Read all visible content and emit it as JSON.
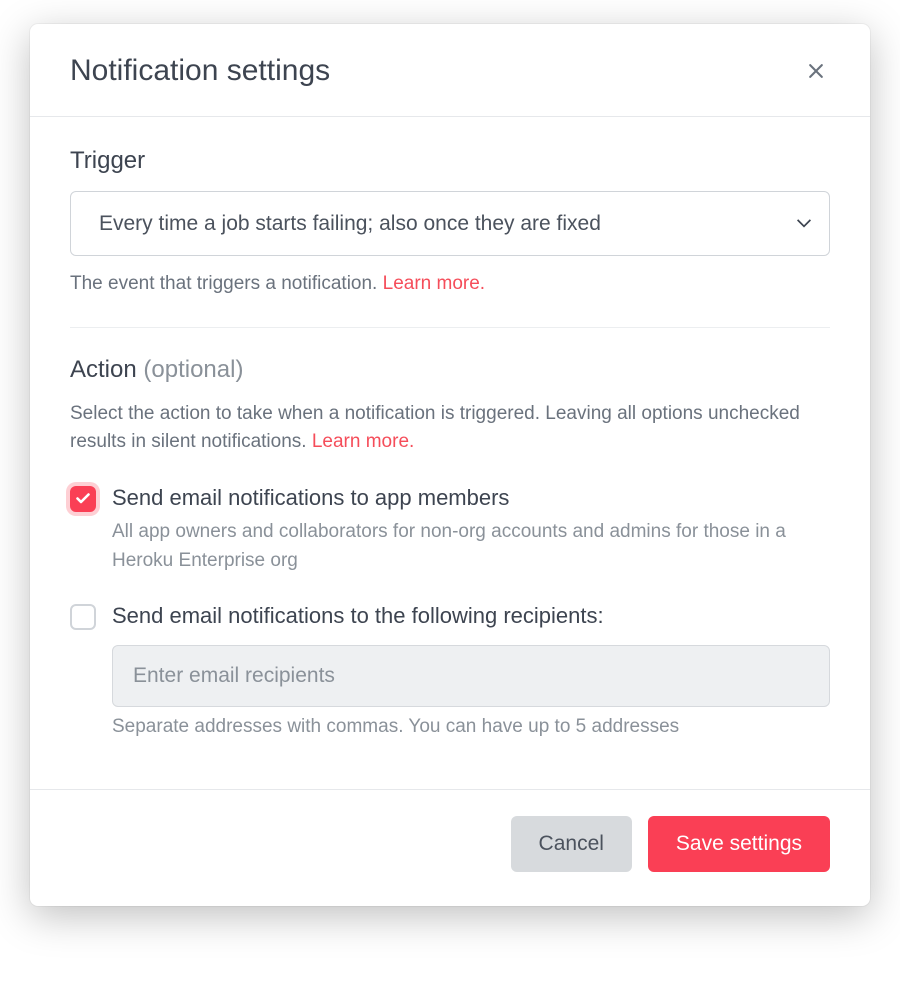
{
  "header": {
    "title": "Notification settings"
  },
  "trigger": {
    "label": "Trigger",
    "selected": "Every time a job starts failing; also once they are fixed",
    "help": "The event that triggers a notification.  ",
    "learn_more": "Learn more."
  },
  "action": {
    "label": "Action ",
    "optional": "(optional)",
    "help": "Select the action to take when a notification is triggered. Leaving all options unchecked results in silent notifications. ",
    "learn_more": "Learn more.",
    "option1": {
      "checked": true,
      "label": "Send email notifications to app members",
      "sub": "All app owners and collaborators for non-org accounts and admins for those in a Heroku Enterprise org"
    },
    "option2": {
      "checked": false,
      "label": "Send email notifications to the following recipients:",
      "placeholder": "Enter email recipients",
      "value": "",
      "sub": "Separate addresses with commas. You can have up to 5 addresses"
    }
  },
  "footer": {
    "cancel": "Cancel",
    "save": "Save settings"
  }
}
